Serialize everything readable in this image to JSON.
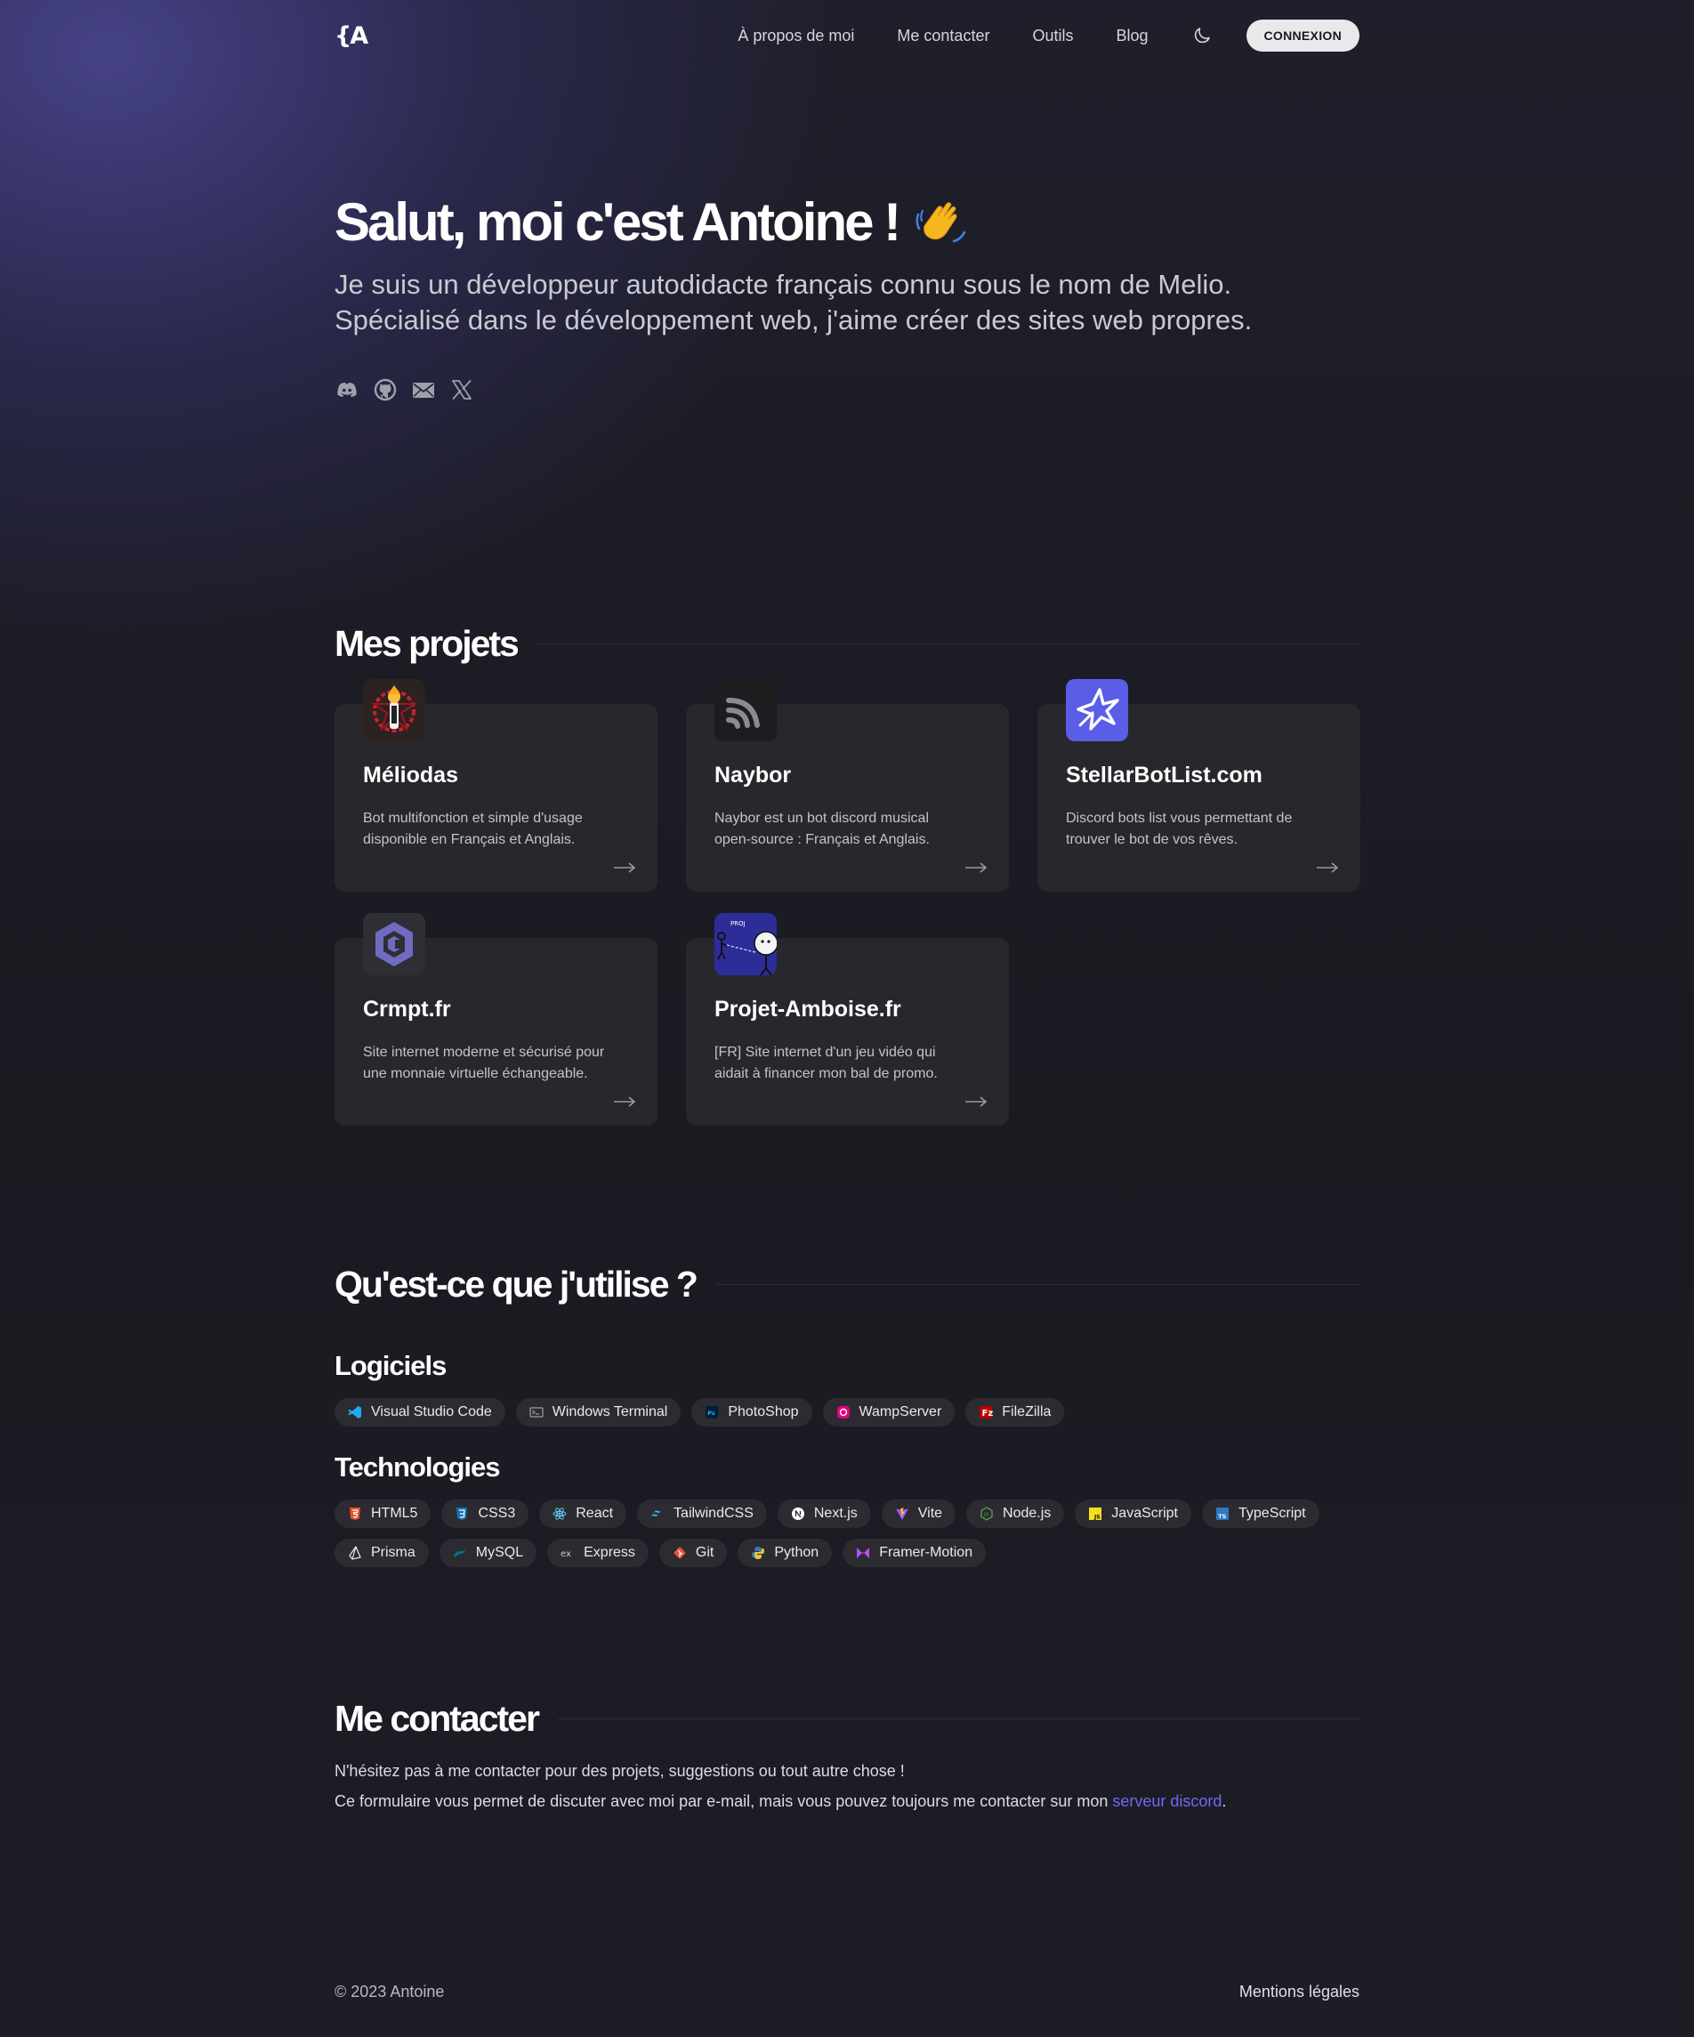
{
  "nav": {
    "logo": "{A",
    "links": [
      "À propos de moi",
      "Me contacter",
      "Outils",
      "Blog"
    ],
    "login_label": "CONNEXION"
  },
  "hero": {
    "title": "Salut, moi c'est Antoine !",
    "subtitle_line1": "Je suis un développeur autodidacte français connu sous le nom de Melio.",
    "subtitle_line2": "Spécialisé dans le développement web, j'aime créer des sites web propres.",
    "socials": [
      "discord-icon",
      "github-icon",
      "mail-icon",
      "x-icon"
    ]
  },
  "projects": {
    "title": "Mes projets",
    "items": [
      {
        "name": "Méliodas",
        "desc_line1": "Bot multifonction et simple d'usage",
        "desc_line2": "disponible en Français et Anglais.",
        "icon": "meliodas-icon"
      },
      {
        "name": "Naybor",
        "desc_line1": "Naybor est un bot discord musical",
        "desc_line2": "open-source : Français et Anglais.",
        "icon": "naybor-icon"
      },
      {
        "name": "StellarBotList.com",
        "desc_line1": "Discord bots list vous permettant de",
        "desc_line2": "trouver le bot de vos rêves.",
        "icon": "stellar-icon"
      },
      {
        "name": "Crmpt.fr",
        "desc_line1": "Site internet moderne et sécurisé pour",
        "desc_line2": "une monnaie virtuelle échangeable.",
        "icon": "crmpt-icon"
      },
      {
        "name": "Projet-Amboise.fr",
        "desc_line1": "[FR] Site internet d'un jeu vidéo qui",
        "desc_line2": "aidait à financer mon bal de promo.",
        "icon": "amboise-icon"
      }
    ]
  },
  "tools": {
    "title": "Qu'est-ce que j'utilise ?",
    "software_title": "Logiciels",
    "software": [
      {
        "label": "Visual Studio Code",
        "icon": "vscode-icon",
        "color": "#23a9f2"
      },
      {
        "label": "Windows Terminal",
        "icon": "terminal-icon",
        "color": "#9aa0a6"
      },
      {
        "label": "PhotoShop",
        "icon": "photoshop-icon",
        "color": "#31a8ff"
      },
      {
        "label": "WampServer",
        "icon": "wampserver-icon",
        "color": "#e5007e"
      },
      {
        "label": "FileZilla",
        "icon": "filezilla-icon",
        "color": "#bf0000"
      }
    ],
    "tech_title": "Technologies",
    "technologies": [
      {
        "label": "HTML5",
        "icon": "html5-icon",
        "color": "#e34f26"
      },
      {
        "label": "CSS3",
        "icon": "css3-icon",
        "color": "#1572b6"
      },
      {
        "label": "React",
        "icon": "react-icon",
        "color": "#61dafb"
      },
      {
        "label": "TailwindCSS",
        "icon": "tailwind-icon",
        "color": "#38bdf8"
      },
      {
        "label": "Next.js",
        "icon": "nextjs-icon",
        "color": "#ffffff"
      },
      {
        "label": "Vite",
        "icon": "vite-icon",
        "color": "#a259ff"
      },
      {
        "label": "Node.js",
        "icon": "nodejs-icon",
        "color": "#539e43"
      },
      {
        "label": "JavaScript",
        "icon": "javascript-icon",
        "color": "#f7df1e"
      },
      {
        "label": "TypeScript",
        "icon": "typescript-icon",
        "color": "#3178c6"
      },
      {
        "label": "Prisma",
        "icon": "prisma-icon",
        "color": "#e6e6e6"
      },
      {
        "label": "MySQL",
        "icon": "mysql-icon",
        "color": "#00758f"
      },
      {
        "label": "Express",
        "icon": "express-icon",
        "color": "#cfcfcf"
      },
      {
        "label": "Git",
        "icon": "git-icon",
        "color": "#f05032"
      },
      {
        "label": "Python",
        "icon": "python-icon",
        "color": "#3776ab"
      },
      {
        "label": "Framer-Motion",
        "icon": "framer-motion-icon",
        "color": "#bb4bff"
      }
    ]
  },
  "contact": {
    "title": "Me contacter",
    "line1": "N'hésitez pas à me contacter pour des projets, suggestions ou tout autre chose !",
    "line2_prefix": "Ce formulaire vous permet de discuter avec moi par e-mail, mais vous pouvez toujours me contacter sur mon ",
    "line2_link": "serveur discord",
    "line2_suffix": "."
  },
  "footer": {
    "copyright": "© 2023 Antoine",
    "legal": "Mentions légales"
  },
  "colors": {
    "accent_link": "#6b6bf5",
    "card_bg": "#27272c",
    "chip_bg": "#2b2b31"
  }
}
